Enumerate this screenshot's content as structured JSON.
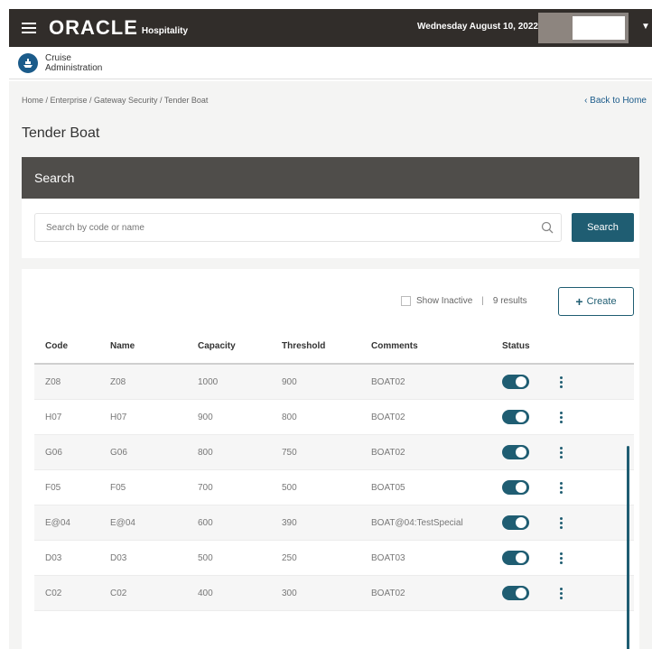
{
  "header": {
    "brand": "ORACLE",
    "brand_sub": "Hospitality",
    "date": "Wednesday August 10, 2022"
  },
  "app": {
    "name_line1": "Cruise",
    "name_line2": "Administration"
  },
  "breadcrumb": "Home / Enterprise / Gateway Security / Tender Boat",
  "back_home": "‹ Back to Home",
  "page_title": "Tender Boat",
  "search": {
    "header": "Search",
    "placeholder": "Search by code or name",
    "button": "Search"
  },
  "toolbar": {
    "show_inactive": "Show Inactive",
    "separator": "|",
    "results": "9 results",
    "create": "Create"
  },
  "table": {
    "columns": [
      "Code",
      "Name",
      "Capacity",
      "Threshold",
      "Comments",
      "Status"
    ],
    "rows": [
      {
        "code": "Z08",
        "name": "Z08",
        "capacity": "1000",
        "threshold": "900",
        "comments": "BOAT02"
      },
      {
        "code": "H07",
        "name": "H07",
        "capacity": "900",
        "threshold": "800",
        "comments": "BOAT02"
      },
      {
        "code": "G06",
        "name": "G06",
        "capacity": "800",
        "threshold": "750",
        "comments": "BOAT02"
      },
      {
        "code": "F05",
        "name": "F05",
        "capacity": "700",
        "threshold": "500",
        "comments": "BOAT05"
      },
      {
        "code": "E@04",
        "name": "E@04",
        "capacity": "600",
        "threshold": "390",
        "comments": "BOAT@04:TestSpecial"
      },
      {
        "code": "D03",
        "name": "D03",
        "capacity": "500",
        "threshold": "250",
        "comments": "BOAT03"
      },
      {
        "code": "C02",
        "name": "C02",
        "capacity": "400",
        "threshold": "300",
        "comments": "BOAT02"
      }
    ]
  },
  "colors": {
    "topbar": "#312d2a",
    "accent": "#1f5d72",
    "search_header": "#4f4d4a"
  },
  "icons": {
    "menu": "hamburger-icon",
    "app": "cruise-ship-icon",
    "search": "search-icon",
    "create": "plus-icon",
    "actions": "kebab-menu-icon",
    "user_menu": "chevron-down-icon"
  }
}
